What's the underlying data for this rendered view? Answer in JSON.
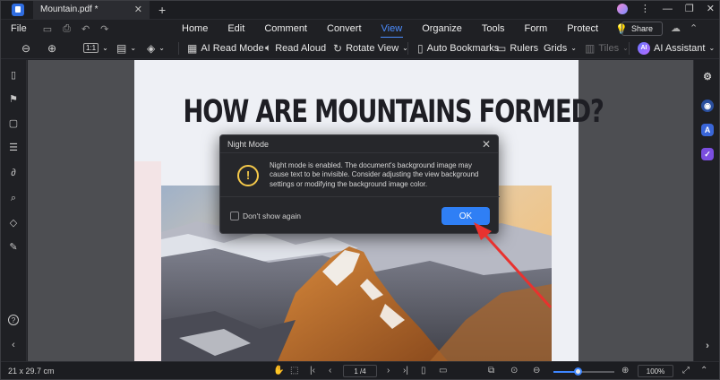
{
  "tab": {
    "title": "Mountain.pdf *"
  },
  "menu": {
    "file": "File",
    "items": [
      "Home",
      "Edit",
      "Comment",
      "Convert",
      "View",
      "Organize",
      "Tools",
      "Form",
      "Protect"
    ],
    "active": "View",
    "share": "Share"
  },
  "toolbar": {
    "zoom_ratio": "1:1",
    "ai_read_mode": "AI Read Mode",
    "read_aloud": "Read Aloud",
    "rotate_view": "Rotate View",
    "auto_bookmarks": "Auto Bookmarks",
    "rulers": "Rulers",
    "grids": "Grids",
    "tiles": "Tiles",
    "ai_assistant": "AI Assistant",
    "ai_badge": "AI"
  },
  "document": {
    "title": "HOW ARE MOUNTAINS FORMED?"
  },
  "dialog": {
    "title": "Night Mode",
    "message": "Night mode is enabled. The document's background image may cause text to be invisible. Consider adjusting the view background settings or modifying the background image color.",
    "checkbox_label": "Don't show again",
    "ok_label": "OK"
  },
  "status": {
    "page_size": "21 x 29.7 cm",
    "page_indicator": "1 /4",
    "zoom": "100%",
    "zoom_level": 0.4
  },
  "colors": {
    "accent": "#2f7ff5",
    "warning": "#f5c94a",
    "arrow": "#e8322f"
  }
}
